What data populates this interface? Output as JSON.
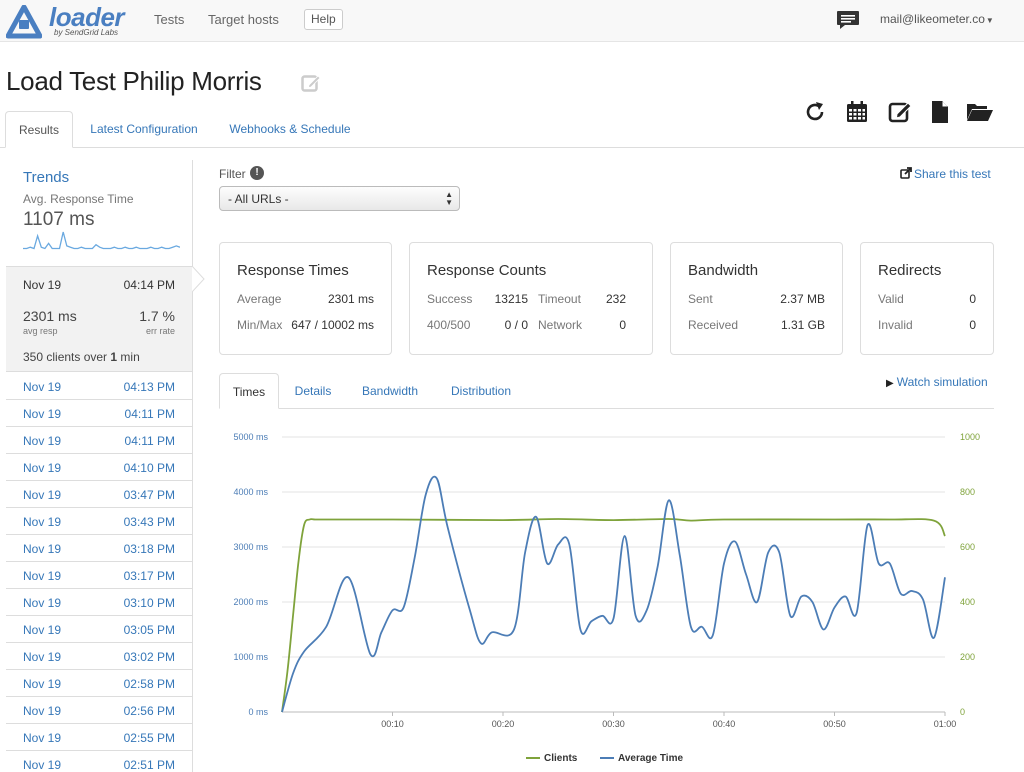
{
  "nav": {
    "logo_word": "loader",
    "logo_sub": "by SendGrid Labs",
    "links": [
      "Tests",
      "Target hosts"
    ],
    "help": "Help",
    "user": "mail@likeometer.co",
    "brand_color": "#4a7fc1"
  },
  "page": {
    "title": "Load Test Philip Morris"
  },
  "tabs": [
    "Results",
    "Latest Configuration",
    "Webhooks & Schedule"
  ],
  "toolbar_icons": [
    "refresh-icon",
    "calendar-icon",
    "edit-icon",
    "file-icon",
    "folder-open-icon"
  ],
  "sidebar": {
    "trends_title": "Trends",
    "trends_sub": "Avg. Response Time",
    "trends_value": "1107 ms",
    "sparkline": [
      2,
      2,
      3,
      2,
      12,
      3,
      2,
      6,
      2,
      2,
      2,
      15,
      4,
      3,
      2,
      2,
      3,
      2,
      2,
      2,
      5,
      3,
      2,
      2,
      2,
      3,
      2,
      2,
      3,
      2,
      2,
      3,
      2,
      2,
      2,
      3,
      2,
      2,
      3,
      2,
      2,
      3,
      4,
      3
    ],
    "selected": {
      "date": "Nov 19",
      "time": "04:14 PM",
      "avg_resp": "2301 ms",
      "avg_resp_label": "avg resp",
      "err_rate": "1.7 %",
      "err_rate_label": "err rate",
      "clients_prefix": "350 clients over ",
      "clients_num": "1",
      "clients_suffix": " min"
    },
    "runs": [
      {
        "date": "Nov 19",
        "time": "04:13 PM"
      },
      {
        "date": "Nov 19",
        "time": "04:11 PM"
      },
      {
        "date": "Nov 19",
        "time": "04:11 PM"
      },
      {
        "date": "Nov 19",
        "time": "04:10 PM"
      },
      {
        "date": "Nov 19",
        "time": "03:47 PM"
      },
      {
        "date": "Nov 19",
        "time": "03:43 PM"
      },
      {
        "date": "Nov 19",
        "time": "03:18 PM"
      },
      {
        "date": "Nov 19",
        "time": "03:17 PM"
      },
      {
        "date": "Nov 19",
        "time": "03:10 PM"
      },
      {
        "date": "Nov 19",
        "time": "03:05 PM"
      },
      {
        "date": "Nov 19",
        "time": "03:02 PM"
      },
      {
        "date": "Nov 19",
        "time": "02:58 PM"
      },
      {
        "date": "Nov 19",
        "time": "02:56 PM"
      },
      {
        "date": "Nov 19",
        "time": "02:55 PM"
      },
      {
        "date": "Nov 19",
        "time": "02:51 PM"
      }
    ]
  },
  "filter": {
    "label": "Filter",
    "info": "!",
    "selected": "- All URLs -"
  },
  "share": "Share this test",
  "cards": {
    "response_times": {
      "title": "Response Times",
      "average_label": "Average",
      "average": "2301 ms",
      "minmax_label": "Min/Max",
      "minmax": "647 / 10002 ms"
    },
    "response_counts": {
      "title": "Response Counts",
      "success_label": "Success",
      "success": "13215",
      "timeout_label": "Timeout",
      "timeout": "232",
      "c400_label": "400/500",
      "c400": "0 / 0",
      "network_label": "Network",
      "network": "0"
    },
    "bandwidth": {
      "title": "Bandwidth",
      "sent_label": "Sent",
      "sent": "2.37 MB",
      "received_label": "Received",
      "received": "1.31 GB"
    },
    "redirects": {
      "title": "Redirects",
      "valid_label": "Valid",
      "valid": "0",
      "invalid_label": "Invalid",
      "invalid": "0"
    }
  },
  "subtabs": [
    "Times",
    "Details",
    "Bandwidth",
    "Distribution"
  ],
  "watch": "Watch simulation",
  "chart_data": {
    "type": "line",
    "x_label_ticks": [
      "00:10",
      "00:20",
      "00:30",
      "00:40",
      "00:50",
      "01:00"
    ],
    "x_label_tick_seconds": [
      10,
      20,
      30,
      40,
      50,
      60
    ],
    "xlim": [
      0,
      60
    ],
    "y_left": {
      "ticks": [
        "0 ms",
        "1000 ms",
        "2000 ms",
        "3000 ms",
        "4000 ms",
        "5000 ms"
      ],
      "range": [
        0,
        5000
      ]
    },
    "y_right": {
      "ticks": [
        "0",
        "200",
        "400",
        "600",
        "800",
        "1000"
      ],
      "range": [
        0,
        1000
      ]
    },
    "grid": true,
    "legend_position": "bottom",
    "series": [
      {
        "name": "Clients",
        "axis": "right",
        "color": "#7fa33b",
        "x": [
          0,
          0.5,
          1,
          1.5,
          2,
          2.5,
          3,
          4,
          10,
          20,
          25,
          30,
          35,
          37,
          40,
          50,
          55,
          59,
          60
        ],
        "values": [
          0,
          150,
          350,
          550,
          680,
          700,
          700,
          700,
          700,
          698,
          702,
          698,
          702,
          696,
          700,
          700,
          700,
          696,
          640
        ]
      },
      {
        "name": "Average Time",
        "axis": "left",
        "color": "#4c7db6",
        "x": [
          0,
          1,
          2,
          4,
          6,
          8,
          9,
          10,
          11,
          12,
          13,
          14,
          15,
          17,
          18,
          19,
          21,
          22,
          23,
          24,
          25,
          26,
          27,
          28,
          29,
          30,
          31,
          32,
          33,
          34,
          35,
          36,
          37,
          38,
          39,
          40,
          41,
          42,
          43,
          44,
          45,
          46,
          47,
          48,
          49,
          50,
          51,
          52,
          53,
          54,
          55,
          56,
          57,
          58,
          59,
          60
        ],
        "values": [
          0,
          700,
          1100,
          1550,
          2450,
          1050,
          1450,
          1850,
          1900,
          2800,
          3950,
          4250,
          3350,
          1850,
          1250,
          1450,
          1500,
          2900,
          3550,
          2700,
          3050,
          3050,
          1500,
          1650,
          1750,
          1700,
          3200,
          1750,
          1850,
          2650,
          3850,
          2850,
          1550,
          1550,
          1400,
          2700,
          3100,
          2500,
          2000,
          2900,
          2900,
          1750,
          2100,
          2000,
          1500,
          1900,
          2100,
          1800,
          3400,
          2700,
          2700,
          2150,
          2200,
          2050,
          1350,
          2450
        ]
      }
    ]
  }
}
